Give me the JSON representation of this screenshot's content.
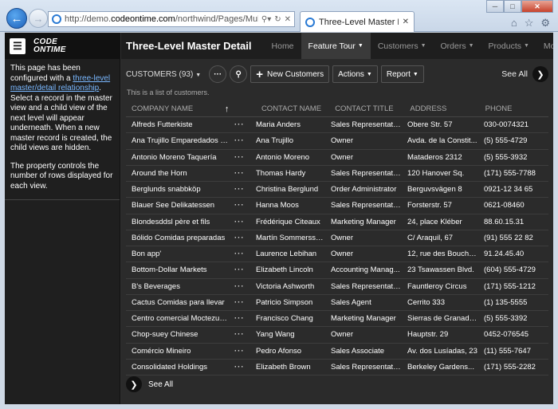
{
  "browser": {
    "url_prefix": "http://demo.",
    "url_domain": "codeontime.com",
    "url_path": "/northwind/Pages/MultiLevelMas",
    "tab_title": "Three-Level Master Detail"
  },
  "sidebar": {
    "logo_line1": "CODE",
    "logo_line2": "ONTIME",
    "help_pre": "This page has been configured with a ",
    "help_link": "three-level master/detail relationship",
    "help_post": ". Select a record in the master view and a child view of the next level will appear underneath. When a new master record is created, the child views are hidden.",
    "help_p2": "The property controls the number of rows displayed for each view."
  },
  "header": {
    "title": "Three-Level Master Detail",
    "nav": [
      {
        "label": "Home"
      },
      {
        "label": "Feature Tour"
      },
      {
        "label": "Customers"
      },
      {
        "label": "Orders"
      },
      {
        "label": "Products"
      },
      {
        "label": "More"
      }
    ]
  },
  "toolbar": {
    "view_selector": "CUSTOMERS (93)",
    "new_label": "New Customers",
    "actions_label": "Actions",
    "report_label": "Report",
    "see_all": "See All"
  },
  "description": "This is a list of customers.",
  "grid": {
    "headers": [
      "COMPANY NAME",
      "CONTACT NAME",
      "CONTACT TITLE",
      "ADDRESS",
      "PHONE"
    ],
    "rows": [
      [
        "Alfreds Futterkiste",
        "Maria Anders",
        "Sales Representative",
        "Obere Str. 57",
        "030-0074321"
      ],
      [
        "Ana Trujillo Emparedados y he...",
        "Ana Trujillo",
        "Owner",
        "Avda. de la Constit...",
        "(5) 555-4729"
      ],
      [
        "Antonio Moreno Taquería",
        "Antonio Moreno",
        "Owner",
        "Mataderos 2312",
        "(5) 555-3932"
      ],
      [
        "Around the Horn",
        "Thomas Hardy",
        "Sales Representative",
        "120 Hanover Sq.",
        "(171) 555-7788"
      ],
      [
        "Berglunds snabbköp",
        "Christina Berglund",
        "Order Administrator",
        "Berguvsvägen 8",
        "0921-12 34 65"
      ],
      [
        "Blauer See Delikatessen",
        "Hanna Moos",
        "Sales Representative",
        "Forsterstr. 57",
        "0621-08460"
      ],
      [
        "Blondesddsl père et fils",
        "Frédérique Citeaux",
        "Marketing Manager",
        "24, place Kléber",
        "88.60.15.31"
      ],
      [
        "Bólido Comidas preparadas",
        "Martín Sommersss...",
        "Owner",
        "C/ Araquil, 67",
        "(91) 555 22 82"
      ],
      [
        "Bon app'",
        "Laurence Lebihan",
        "Owner",
        "12, rue des Bouchers",
        "91.24.45.40"
      ],
      [
        "Bottom-Dollar Markets",
        "Elizabeth Lincoln",
        "Accounting Manag...",
        "23 Tsawassen Blvd.",
        "(604) 555-4729"
      ],
      [
        "B's Beverages",
        "Victoria Ashworth",
        "Sales Representative",
        "Fauntleroy Circus",
        "(171) 555-1212"
      ],
      [
        "Cactus Comidas para llevar",
        "Patricio Simpson",
        "Sales Agent",
        "Cerrito 333",
        "(1) 135-5555"
      ],
      [
        "Centro comercial Moctezuma",
        "Francisco Chang",
        "Marketing Manager",
        "Sierras de Granada...",
        "(5) 555-3392"
      ],
      [
        "Chop-suey Chinese",
        "Yang Wang",
        "Owner",
        "Hauptstr. 29",
        "0452-076545"
      ],
      [
        "Comércio Mineiro",
        "Pedro Afonso",
        "Sales Associate",
        "Av. dos Lusíadas, 23",
        "(11) 555-7647"
      ],
      [
        "Consolidated Holdings",
        "Elizabeth Brown",
        "Sales Representative",
        "Berkeley Gardens...",
        "(171) 555-2282"
      ]
    ]
  },
  "footer": {
    "see_all": "See All"
  },
  "colors": {
    "background": "#2b2b2b",
    "sidebar": "#1f1f1f",
    "link": "#7ab8ff",
    "active_nav": "#3a3a3a"
  }
}
